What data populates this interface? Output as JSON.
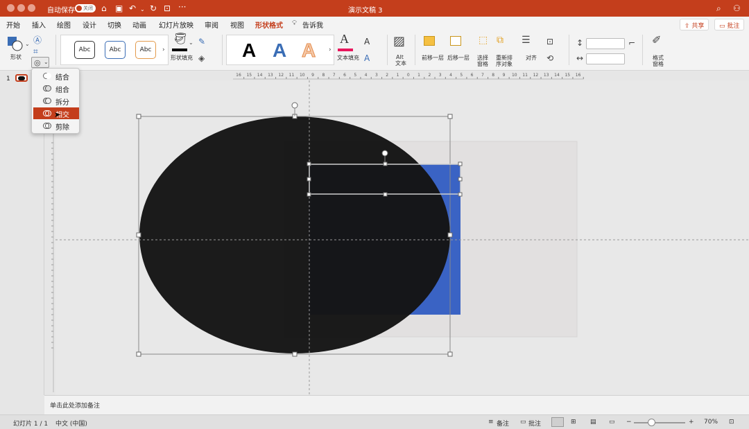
{
  "titlebar": {
    "autosave_label": "自动保存",
    "autosave_state": "关闭",
    "document_title": "演示文稿 3",
    "more": "···"
  },
  "tabs": [
    "开始",
    "插入",
    "绘图",
    "设计",
    "切换",
    "动画",
    "幻灯片放映",
    "审阅",
    "视图",
    "形状格式"
  ],
  "active_tab": "形状格式",
  "tell_me": "告诉我",
  "header_buttons": {
    "share": "共享",
    "comment": "批注"
  },
  "ribbon": {
    "shape_label": "形状",
    "style_samples": [
      "Abc",
      "Abc",
      "Abc"
    ],
    "shape_fill": "形状填充",
    "wordart_samples": [
      "A",
      "A",
      "A"
    ],
    "text_fill": "文本填充",
    "alt_text_line1": "Alt",
    "alt_text_line2": "文本",
    "bring_forward": "前移一层",
    "send_backward": "后移一层",
    "selection_pane_line1": "选择",
    "selection_pane_line2": "窗格",
    "reorder_line1": "重新排",
    "reorder_line2": "序对象",
    "align": "对齐",
    "format_pane_line1": "格式",
    "format_pane_line2": "窗格",
    "height_value": "",
    "width_value": ""
  },
  "merge_menu": {
    "items": [
      "结合",
      "组合",
      "拆分",
      "相交",
      "剪除"
    ],
    "selected": "相交"
  },
  "slide_panel": {
    "slide_number": "1"
  },
  "ruler_labels": [
    "16",
    "15",
    "14",
    "13",
    "12",
    "11",
    "10",
    "9",
    "8",
    "7",
    "6",
    "5",
    "4",
    "3",
    "2",
    "1",
    "0",
    "1",
    "2",
    "3",
    "4",
    "5",
    "6",
    "7",
    "8",
    "9",
    "10",
    "11",
    "12",
    "13",
    "14",
    "15",
    "16"
  ],
  "notes_placeholder": "单击此处添加备注",
  "status": {
    "slide_info": "幻灯片 1 / 1",
    "language": "中文 (中国)",
    "notes": "备注",
    "comments": "批注",
    "zoom": "70%"
  },
  "colors": {
    "accent": "#c43e1c",
    "shape_blue": "#3a63c4",
    "ellipse": "#141414"
  }
}
